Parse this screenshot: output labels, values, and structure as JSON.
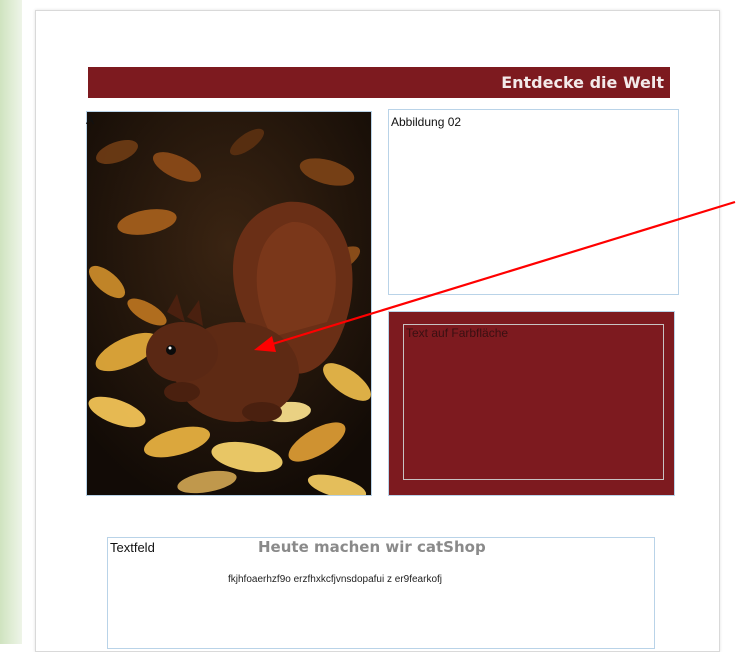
{
  "header": {
    "title": "Entdecke die Welt"
  },
  "image_frame_left": {
    "stray_label": "A",
    "image": "squirrel-in-autumn-leaves-photo"
  },
  "image_frame_right": {
    "label": "Abbildung 02"
  },
  "color_box": {
    "label": "Text auf Farbfläche",
    "color": "#7d1a1f"
  },
  "text_field": {
    "label": "Textfeld",
    "heading": "Heute machen wir catShop",
    "body": "fkjhfoaerhzf9o erzfhxkcfjvnsdopafui z er9fearkofj"
  },
  "annotation": {
    "arrow_color": "#ff0000"
  },
  "colors": {
    "accent": "#7d1a1f",
    "frame_border": "#b9d3e8"
  }
}
